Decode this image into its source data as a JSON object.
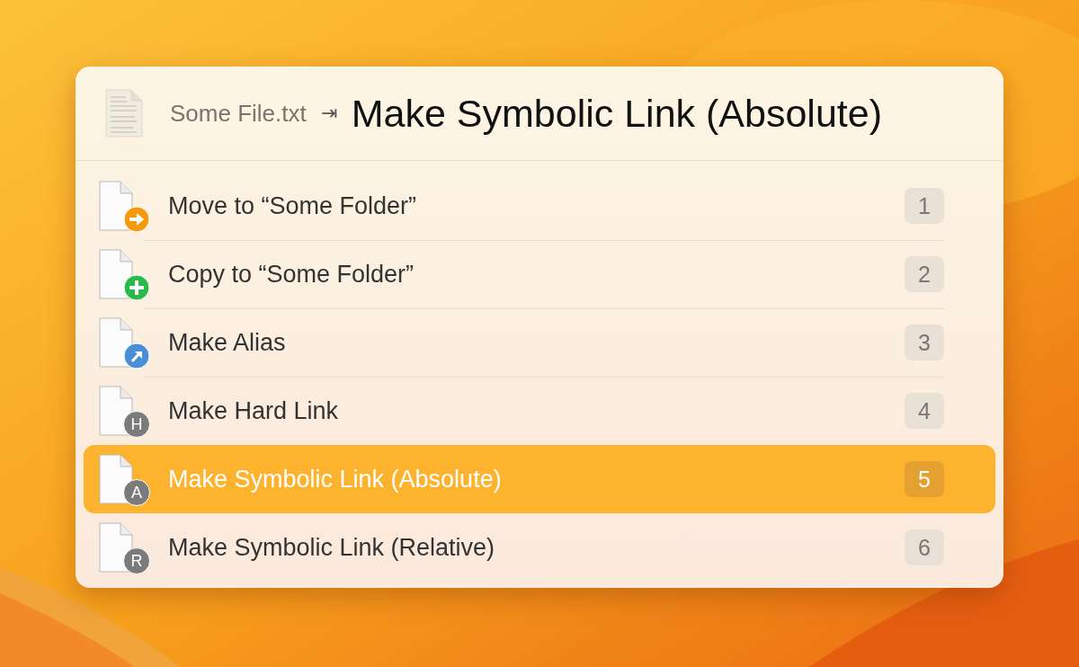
{
  "header": {
    "file_name": "Some File.txt",
    "arrow": "⇥",
    "title": "Make Symbolic Link (Absolute)"
  },
  "items": [
    {
      "label": "Move to “Some Folder”",
      "shortcut": "1",
      "selected": false,
      "kind": "arrow",
      "color": "#f59a0c"
    },
    {
      "label": "Copy to “Some Folder”",
      "shortcut": "2",
      "selected": false,
      "kind": "plus",
      "color": "#2bb94a"
    },
    {
      "label": "Make Alias",
      "shortcut": "3",
      "selected": false,
      "kind": "alias",
      "color": "#4a8fd6"
    },
    {
      "label": "Make Hard Link",
      "shortcut": "4",
      "selected": false,
      "kind": "letter",
      "letter": "H",
      "color": "#7b7b7b"
    },
    {
      "label": "Make Symbolic Link (Absolute)",
      "shortcut": "5",
      "selected": true,
      "kind": "letter",
      "letter": "A",
      "color": "#7b7b7b"
    },
    {
      "label": "Make Symbolic Link (Relative)",
      "shortcut": "6",
      "selected": false,
      "kind": "letter",
      "letter": "R",
      "color": "#7b7b7b"
    }
  ]
}
